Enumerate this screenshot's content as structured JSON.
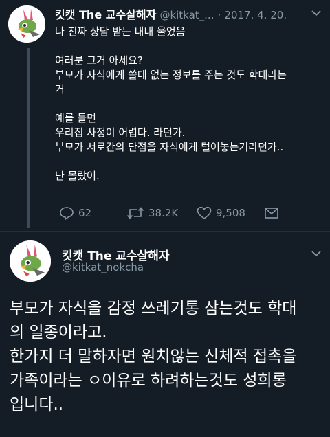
{
  "tweet1": {
    "display_name": "킷캣 The 교수살해자",
    "handle": "@kitkat_...",
    "separator": "·",
    "date": "2017. 4. 20.",
    "lines": [
      "나 진짜 상담 받는 내내 울었음",
      "",
      "여러분 그거 아세요?",
      "부모가 자식에게 쓸데 없는 정보를 주는 것도 학대라는",
      "거",
      "",
      "예를 들면",
      "우리집 사정이 어렵다. 라던가.",
      "부모가 서로간의 단점을 자식에게 털어놓는거라던가..",
      "",
      "난 몰랐어."
    ],
    "replies": "62",
    "retweets": "38.2K",
    "likes": "9,508"
  },
  "tweet2": {
    "display_name": "킷캣 The 교수살해자",
    "handle": "@kitkat_nokcha",
    "lines": [
      "부모가 자식을 감정 쓰레기통 삼는것도 학대",
      "의 일종이라고.",
      "한가지 더 말하자면 원치않는 신체적 접촉을",
      "가족이라는 ㅇ이유로 하려하는것도 성희롱",
      "입니다.."
    ]
  },
  "icons": {
    "reply": "reply-icon",
    "retweet": "retweet-icon",
    "like": "heart-icon",
    "dm": "message-icon",
    "chevron": "chevron-down-icon"
  },
  "colors": {
    "background": "#141d26",
    "secondary_text": "#8899a6",
    "primary_text": "#ffffff"
  }
}
